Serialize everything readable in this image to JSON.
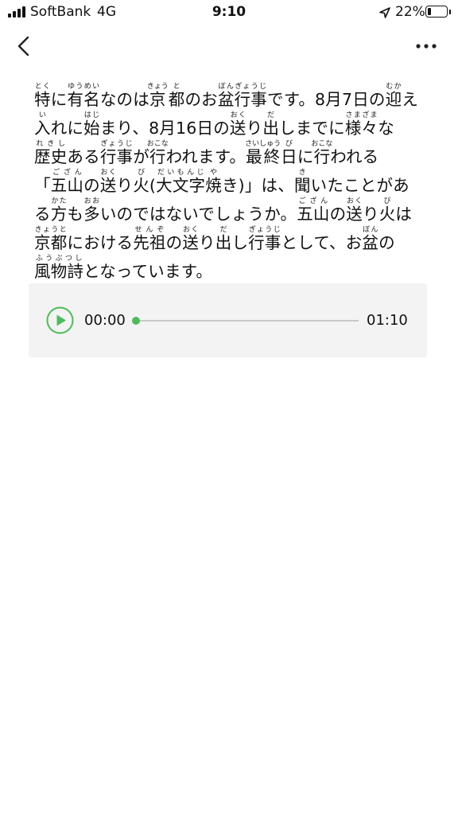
{
  "status_bar": {
    "carrier": "SoftBank",
    "network": "4G",
    "time": "9:10",
    "battery_percent_label": "22%",
    "battery_level": 0.22,
    "icons": [
      "signal-bars-icon",
      "location-arrow-icon",
      "battery-icon"
    ]
  },
  "nav": {
    "back_icon": "chevron-left-icon",
    "more_icon": "more-horizontal-icon"
  },
  "article": {
    "paragraph": [
      {
        "t": "特",
        "r": "とく"
      },
      {
        "t": "に"
      },
      {
        "t": "有名",
        "r": "ゆうめい"
      },
      {
        "t": "なのは"
      },
      {
        "t": "京",
        "r": "きょう"
      },
      {
        "t": "都",
        "r": "と"
      },
      {
        "t": "のお"
      },
      {
        "t": "盆",
        "r": "ぼん"
      },
      {
        "t": "行事",
        "r": "ぎょうじ"
      },
      {
        "t": "です。8月7日の"
      },
      {
        "t": "迎",
        "r": "むか"
      },
      {
        "t": "え"
      },
      {
        "t": "入",
        "r": "い"
      },
      {
        "t": "れに"
      },
      {
        "t": "始",
        "r": "はじ"
      },
      {
        "t": "まり、8月16日の"
      },
      {
        "t": "送",
        "r": "おく"
      },
      {
        "t": "り"
      },
      {
        "t": "出",
        "r": "だ"
      },
      {
        "t": "しまでに"
      },
      {
        "t": "様々",
        "r": "さまざま"
      },
      {
        "t": "な"
      },
      {
        "t": "歴史",
        "r": "れきし"
      },
      {
        "t": "ある"
      },
      {
        "t": "行事",
        "r": "ぎょうじ"
      },
      {
        "t": "が"
      },
      {
        "t": "行",
        "r": "おこな"
      },
      {
        "t": "われます。"
      },
      {
        "t": "最終",
        "r": "さいしゅう"
      },
      {
        "t": "日",
        "r": "び"
      },
      {
        "t": "に"
      },
      {
        "t": "行",
        "r": "おこな"
      },
      {
        "t": "われる「"
      },
      {
        "t": "五山",
        "r": "ござん"
      },
      {
        "t": "の"
      },
      {
        "t": "送",
        "r": "おく"
      },
      {
        "t": "り"
      },
      {
        "t": "火",
        "r": "び"
      },
      {
        "t": "("
      },
      {
        "t": "大文字",
        "r": "だいもんじ"
      },
      {
        "t": "焼",
        "r": "や"
      },
      {
        "t": "き)」は、"
      },
      {
        "t": "聞",
        "r": "き"
      },
      {
        "t": "いたことがある"
      },
      {
        "t": "方",
        "r": "かた"
      },
      {
        "t": "も"
      },
      {
        "t": "多",
        "r": "おお"
      },
      {
        "t": "いのではないでしょうか。"
      },
      {
        "t": "五山",
        "r": "ござん"
      },
      {
        "t": "の"
      },
      {
        "t": "送",
        "r": "おく"
      },
      {
        "t": "り"
      },
      {
        "t": "火",
        "r": "び"
      },
      {
        "t": "は"
      },
      {
        "t": "京都",
        "r": "きょうと"
      },
      {
        "t": "にお"
      },
      {
        "t": "ける"
      },
      {
        "t": "先祖",
        "r": "せんぞ"
      },
      {
        "t": "の"
      },
      {
        "t": "送",
        "r": "おく"
      },
      {
        "t": "り"
      },
      {
        "t": "出",
        "r": "だ"
      },
      {
        "t": "し"
      },
      {
        "t": "行事",
        "r": "ぎょうじ"
      },
      {
        "t": "として、お"
      },
      {
        "t": "盆",
        "r": "ぼん"
      },
      {
        "t": "の"
      },
      {
        "t": "風物詩",
        "r": "ふうぶつし"
      },
      {
        "t": "となっ"
      },
      {
        "t": "ています。"
      }
    ]
  },
  "player": {
    "current_time": "00:00",
    "total_time": "01:10",
    "progress": 0,
    "play_icon": "play-circle-icon",
    "accent_color": "#4cbb5a"
  }
}
